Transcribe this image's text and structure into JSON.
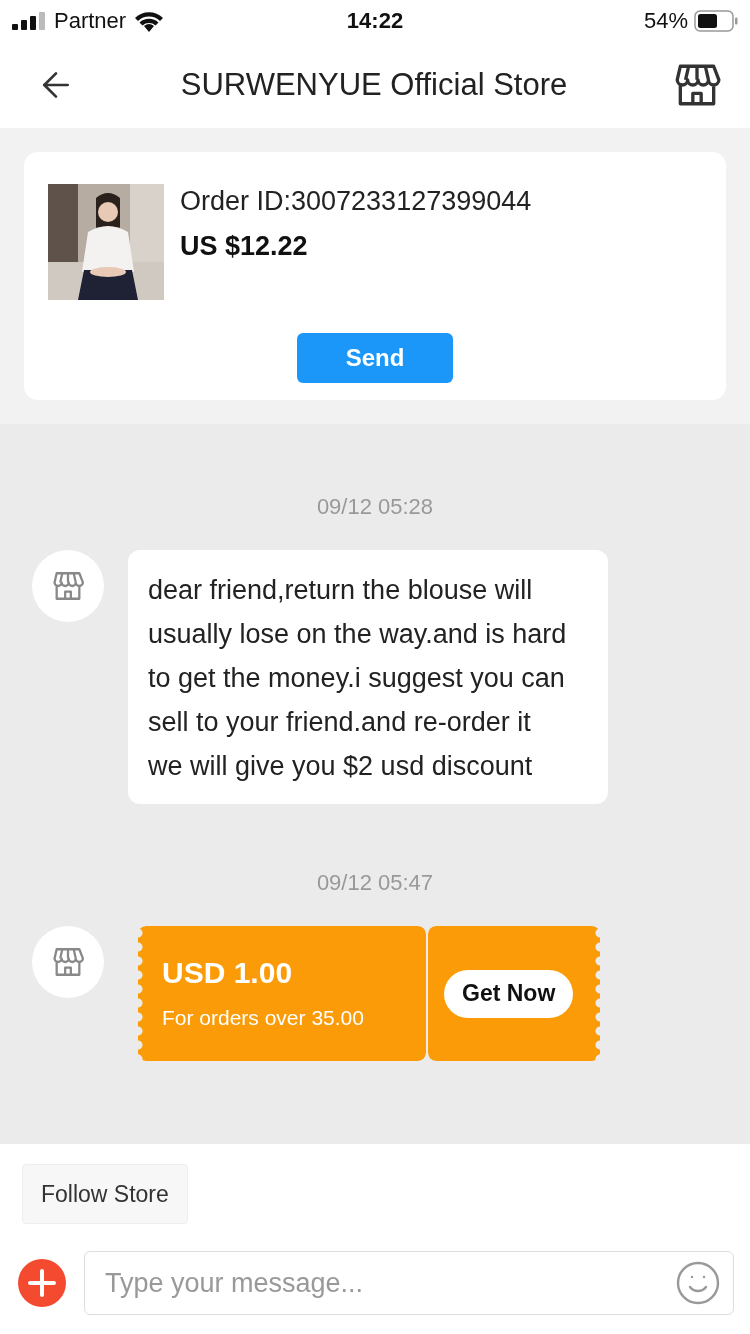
{
  "status_bar": {
    "carrier": "Partner",
    "time": "14:22",
    "battery": "54%"
  },
  "header": {
    "title": "SURWENYUE Official Store"
  },
  "order_card": {
    "order_id": "Order ID:3007233127399044",
    "price": "US $12.22",
    "button": "Send"
  },
  "messages": [
    {
      "kind": "text",
      "timestamp": "09/12 05:28",
      "text": "dear friend,return the blouse will usually lose on the way.and is hard to get the money.i suggest you can sell to your friend.and re-order it we will give you $2 usd discount"
    },
    {
      "kind": "coupon",
      "timestamp": "09/12 05:47",
      "amount": "USD 1.00",
      "condition": "For orders over 35.00",
      "button": "Get Now"
    }
  ],
  "quick_actions": [
    "Follow Store"
  ],
  "composer": {
    "placeholder": "Type your message..."
  }
}
